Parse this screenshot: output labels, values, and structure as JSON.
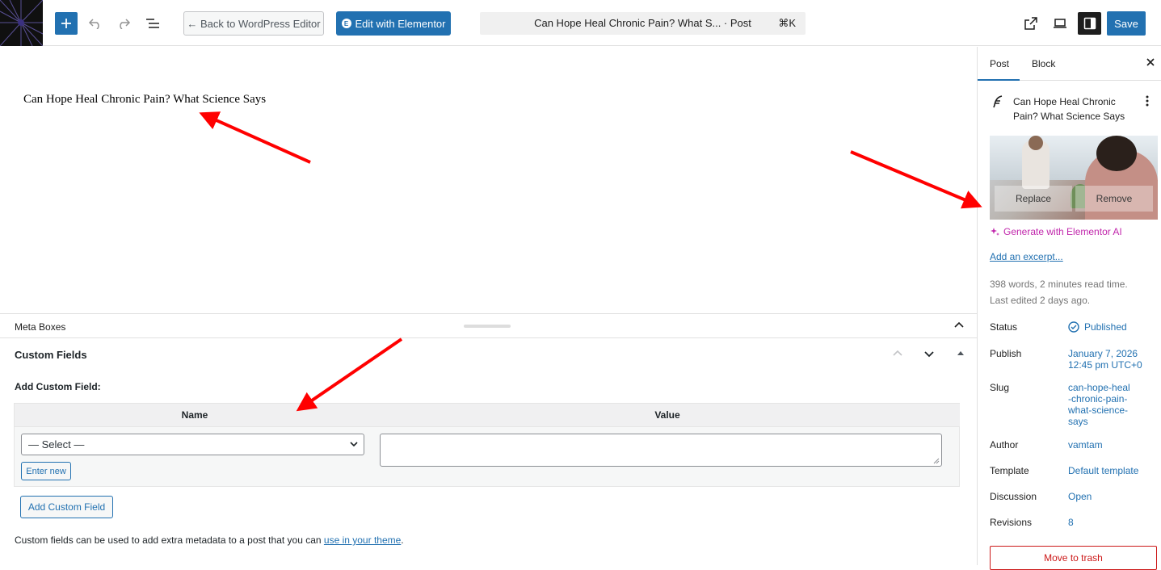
{
  "topbar": {
    "back_label": "← Back to WordPress Editor",
    "elementor_label": "Edit with Elementor",
    "command_title": "Can Hope Heal Chronic Pain? What S...  · Post",
    "command_shortcut": "⌘K",
    "save_label": "Save"
  },
  "editor": {
    "post_title": "Can Hope Heal Chronic Pain? What Science Says"
  },
  "meta": {
    "header": "Meta Boxes",
    "custom_fields_title": "Custom Fields",
    "add_label": "Add Custom Field:",
    "col_name": "Name",
    "col_value": "Value",
    "select_value": "— Select —",
    "enter_new": "Enter new",
    "add_button": "Add Custom Field",
    "help_text": "Custom fields can be used to add extra metadata to a post that you can ",
    "help_link": "use in your theme",
    "help_end": "."
  },
  "sidebar": {
    "tab_post": "Post",
    "tab_block": "Block",
    "post_title": "Can Hope Heal Chronic Pain? What Science Says",
    "replace_label": "Replace",
    "remove_label": "Remove",
    "generate_ai": "Generate with Elementor AI",
    "add_excerpt": "Add an excerpt...",
    "word_stats": "398 words, 2 minutes read time.",
    "last_edited": "Last edited 2 days ago.",
    "rows": [
      {
        "label": "Status",
        "value": "Published"
      },
      {
        "label": "Publish",
        "value": "January 7, 2026 12:45 pm UTC+0"
      },
      {
        "label": "Slug",
        "value": "can-hope-heal-chronic-pain-what-science-says"
      },
      {
        "label": "Author",
        "value": "vamtam"
      },
      {
        "label": "Template",
        "value": "Default template"
      },
      {
        "label": "Discussion",
        "value": "Open"
      },
      {
        "label": "Revisions",
        "value": "8"
      }
    ],
    "trash_label": "Move to trash"
  },
  "colors": {
    "accent": "#2271b1",
    "ai": "#c127ac",
    "danger": "#cc1818",
    "arrow": "#ff0000"
  }
}
